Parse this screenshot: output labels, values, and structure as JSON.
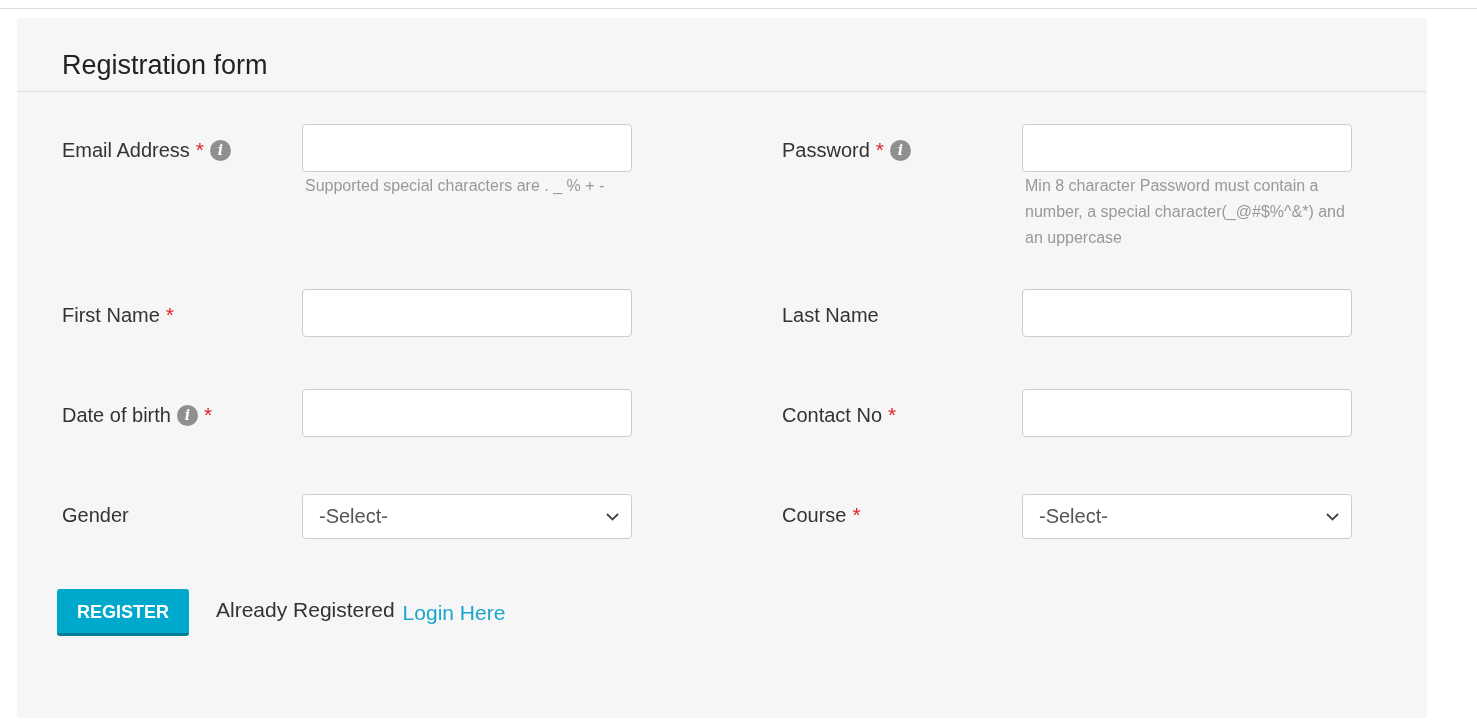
{
  "form": {
    "title": "Registration form",
    "rows": [
      [
        {
          "label": "Email Address",
          "marks": [
            {
              "kind": "asterisk",
              "text": "*"
            },
            {
              "kind": "info",
              "text": "i"
            }
          ],
          "kind": "text",
          "help": "Supported special characters are . _ % + -"
        },
        {
          "label": "Password",
          "marks": [
            {
              "kind": "asterisk",
              "text": "*"
            },
            {
              "kind": "info",
              "text": "i"
            }
          ],
          "kind": "text",
          "help": "Min 8 character Password must contain a number, a special character(_@#$%^&*) and an uppercase"
        }
      ],
      [
        {
          "label": "First Name",
          "marks": [
            {
              "kind": "asterisk",
              "text": "*"
            }
          ],
          "kind": "text"
        },
        {
          "label": "Last Name",
          "kind": "text"
        }
      ],
      [
        {
          "label": "Date of birth",
          "marks": [
            {
              "kind": "info",
              "text": "i"
            },
            {
              "kind": "asterisk",
              "text": "*"
            }
          ],
          "kind": "text"
        },
        {
          "label": "Contact No",
          "marks": [
            {
              "kind": "asterisk",
              "text": "*"
            }
          ],
          "kind": "text"
        }
      ],
      [
        {
          "label": "Gender",
          "kind": "select",
          "value": "-Select-"
        },
        {
          "label": "Course",
          "marks": [
            {
              "kind": "asterisk",
              "text": "*"
            }
          ],
          "kind": "select",
          "value": "-Select-"
        }
      ]
    ],
    "submit": "REGISTER",
    "login_prompt": "Already Registered",
    "login_link": "Login Here"
  }
}
